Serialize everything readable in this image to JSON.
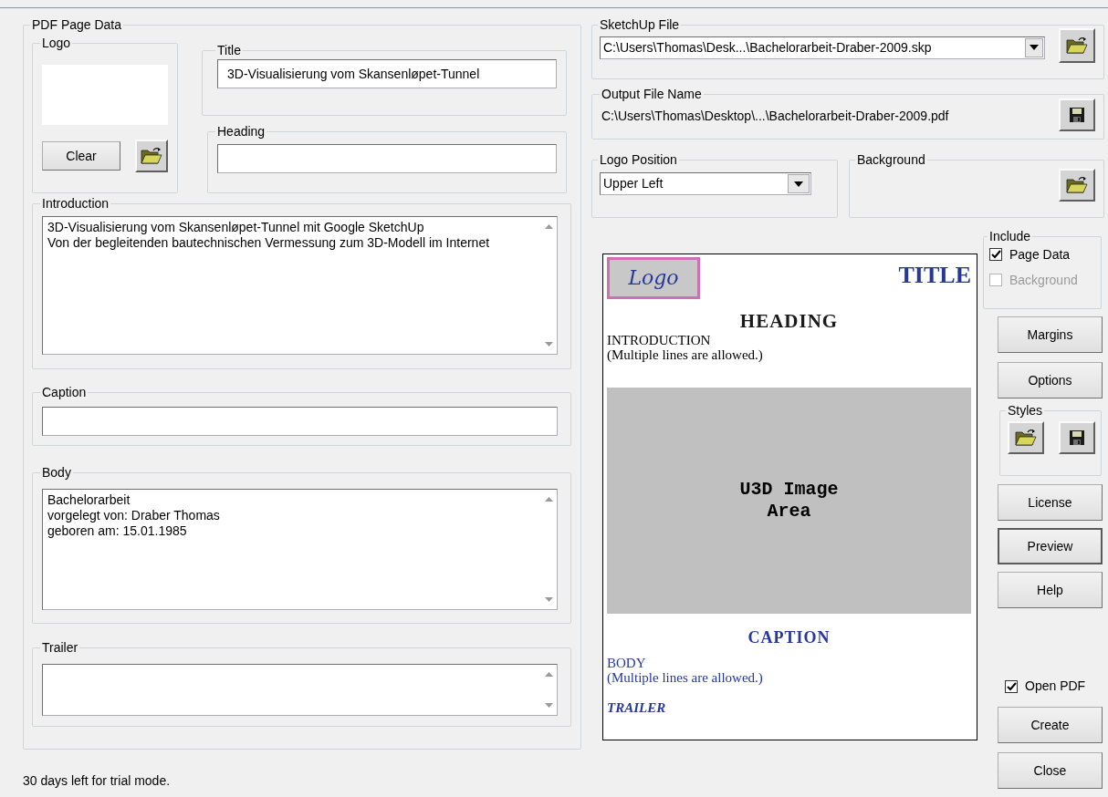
{
  "pdf_page_data": {
    "label": "PDF Page Data",
    "logo": {
      "label": "Logo",
      "clear_button": "Clear"
    },
    "title": {
      "label": "Title",
      "value": "3D-Visualisierung vom Skansenløpet-Tunnel"
    },
    "heading": {
      "label": "Heading"
    },
    "introduction": {
      "label": "Introduction",
      "lines": [
        "3D-Visualisierung vom Skansenløpet-Tunnel mit Google SketchUp",
        "Von der begleitenden bautechnischen Vermessung zum 3D-Modell im Internet"
      ]
    },
    "caption": {
      "label": "Caption"
    },
    "body": {
      "label": "Body",
      "lines": [
        "Bachelorarbeit",
        "vorgelegt von: Draber Thomas",
        "geboren am: 15.01.1985"
      ]
    },
    "trailer": {
      "label": "Trailer"
    }
  },
  "sketchup_file": {
    "label": "SketchUp File",
    "value": "C:\\Users\\Thomas\\Desk...\\Bachelorarbeit-Draber-2009.skp"
  },
  "output_file": {
    "label": "Output File Name",
    "value": "C:\\Users\\Thomas\\Desktop\\...\\Bachelorarbeit-Draber-2009.pdf"
  },
  "logo_position": {
    "label": "Logo Position",
    "value": "Upper Left"
  },
  "background": {
    "label": "Background"
  },
  "preview": {
    "logo": "Logo",
    "title": "TITLE",
    "heading": "HEADING",
    "introduction": [
      "INTRODUCTION",
      "(Multiple lines are allowed.)"
    ],
    "image_area": [
      "U3D Image",
      "Area"
    ],
    "caption": "CAPTION",
    "body": [
      "BODY",
      "(Multiple lines are allowed.)"
    ],
    "trailer": "TRAILER"
  },
  "include": {
    "label": "Include",
    "options": [
      {
        "label": "Page Data",
        "checked": true,
        "disabled": false
      },
      {
        "label": "Background",
        "checked": false,
        "disabled": true
      }
    ]
  },
  "upper_buttons": [
    {
      "label": "Margins",
      "default": false
    },
    {
      "label": "Options",
      "default": false
    }
  ],
  "styles": {
    "label": "Styles"
  },
  "lower_buttons": [
    {
      "label": "License",
      "default": false
    },
    {
      "label": "Preview",
      "default": true
    },
    {
      "label": "Help",
      "default": false
    }
  ],
  "open_pdf": {
    "label": "Open PDF",
    "checked": true
  },
  "actions": [
    "Create",
    "Close"
  ],
  "status_bar": {
    "text": "30 days left for trial mode."
  }
}
